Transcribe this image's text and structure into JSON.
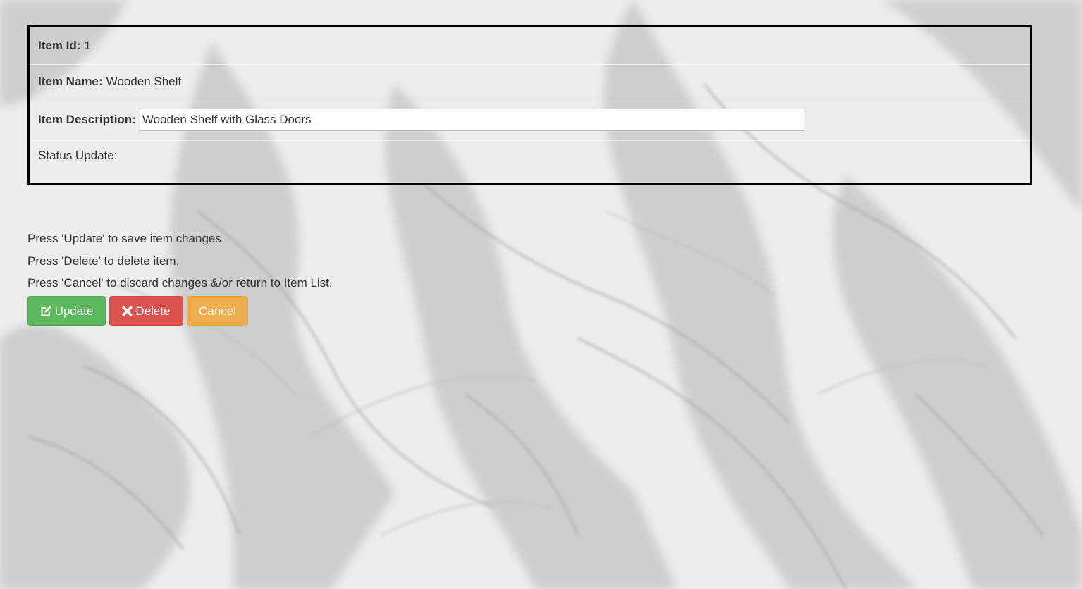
{
  "item": {
    "id_label": "Item Id:",
    "id_value": "1",
    "name_label": "Item Name:",
    "name_value": "Wooden Shelf",
    "description_label": "Item Description:",
    "description_value": "Wooden Shelf with Glass Doors",
    "status_label": "Status Update:"
  },
  "instructions": {
    "update": "Press 'Update' to save item changes.",
    "delete": "Press 'Delete' to delete item.",
    "cancel": "Press 'Cancel' to discard changes &/or return to Item List."
  },
  "buttons": {
    "update_label": "Update",
    "update_icon": "edit-icon",
    "delete_label": "Delete",
    "delete_icon": "close-icon",
    "cancel_label": "Cancel"
  },
  "colors": {
    "update": "#5cb85c",
    "delete": "#d9534f",
    "cancel": "#f0ad4e"
  }
}
